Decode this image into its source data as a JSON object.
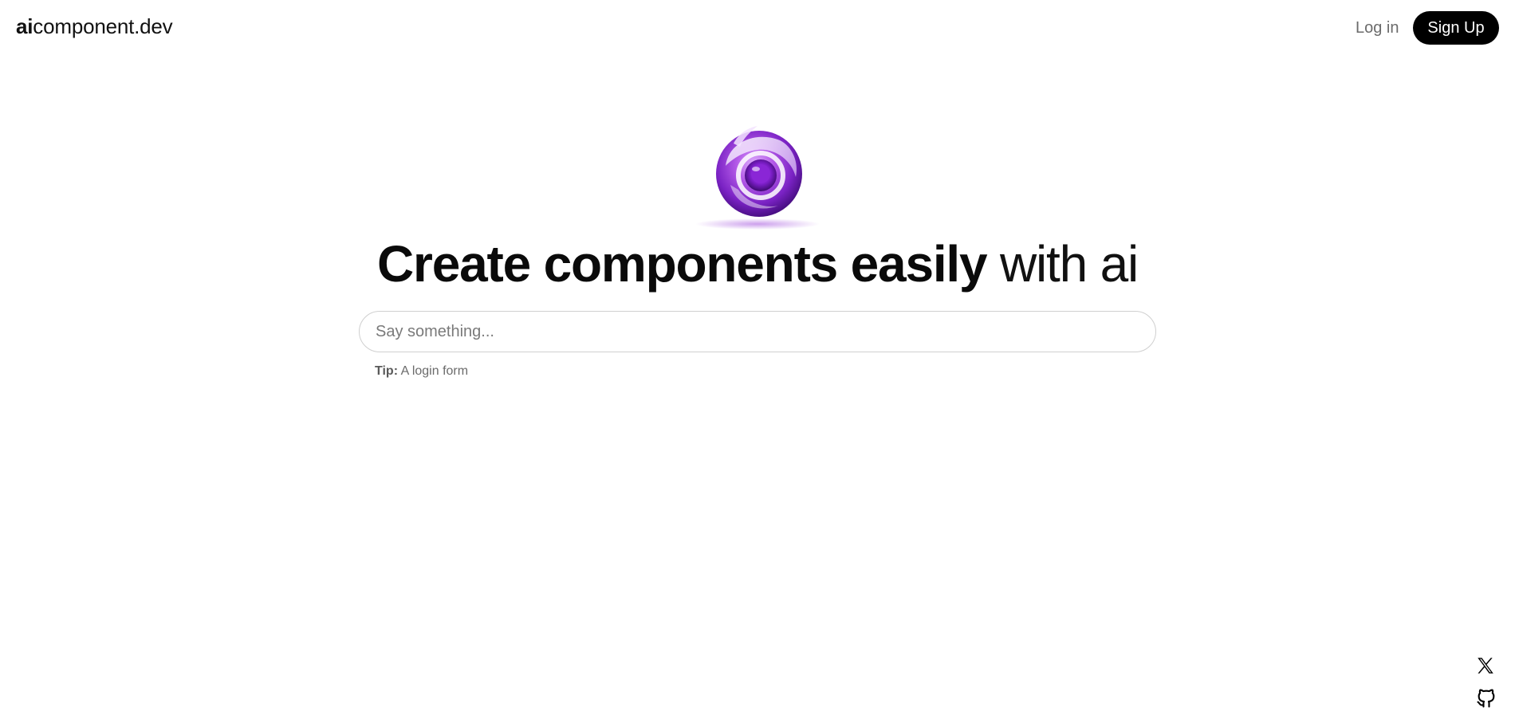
{
  "header": {
    "brand_bold": "ai",
    "brand_rest": "component.dev",
    "login_label": "Log in",
    "signup_label": "Sign Up"
  },
  "hero": {
    "logo_icon": "purple-orb-logo-icon",
    "headline_bold": "Create components easily",
    "headline_light": " with ai"
  },
  "prompt": {
    "placeholder": "Say something...",
    "value": ""
  },
  "tip": {
    "label": "Tip:",
    "text": " A login form"
  },
  "social": {
    "items": [
      {
        "icon": "x-twitter-icon"
      },
      {
        "icon": "github-icon"
      }
    ]
  },
  "colors": {
    "accent": "#000000",
    "orb_primary": "#8e2bd6",
    "orb_light": "#c98cf0",
    "muted_text": "#6b6b6b"
  }
}
